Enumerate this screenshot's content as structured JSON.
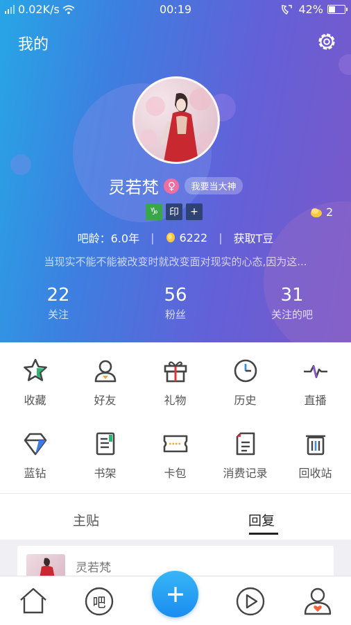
{
  "status_bar": {
    "network_speed": "0.02K/s",
    "time": "00:19",
    "battery_percent": "42%",
    "battery_level": 0.42
  },
  "header": {
    "title": "我的",
    "settings_icon": "gear-icon"
  },
  "profile": {
    "username": "灵若梵",
    "gender_symbol": "♀",
    "god_badge": "我要当大神",
    "badges": [
      "♑",
      "印",
      "+"
    ],
    "tdou_count": "2",
    "age_label": "吧龄：6.0年",
    "coins": "6222",
    "get_tdou": "获取T豆",
    "signature": "当现实不能不能被改变时就改变面对现实的心态,因为这..."
  },
  "stats": [
    {
      "value": "22",
      "label": "关注"
    },
    {
      "value": "56",
      "label": "粉丝"
    },
    {
      "value": "31",
      "label": "关注的吧"
    }
  ],
  "grid": [
    {
      "label": "收藏",
      "icon": "star-icon"
    },
    {
      "label": "好友",
      "icon": "friend-icon"
    },
    {
      "label": "礼物",
      "icon": "gift-icon"
    },
    {
      "label": "历史",
      "icon": "clock-icon"
    },
    {
      "label": "直播",
      "icon": "live-icon"
    },
    {
      "label": "蓝钻",
      "icon": "diamond-icon"
    },
    {
      "label": "书架",
      "icon": "bookshelf-icon"
    },
    {
      "label": "卡包",
      "icon": "ticket-icon"
    },
    {
      "label": "消费记录",
      "icon": "receipt-icon"
    },
    {
      "label": "回收站",
      "icon": "trash-icon"
    }
  ],
  "tabs": [
    {
      "label": "主贴",
      "active": false
    },
    {
      "label": "回复",
      "active": true
    }
  ],
  "feed": {
    "post_author": "灵若梵"
  },
  "bottom_nav": {
    "ba_label": "吧"
  },
  "colors": {
    "accent_blue": "#1a8cf0",
    "gender_pink": "#f06ea0",
    "star_green": "#2bb673"
  }
}
